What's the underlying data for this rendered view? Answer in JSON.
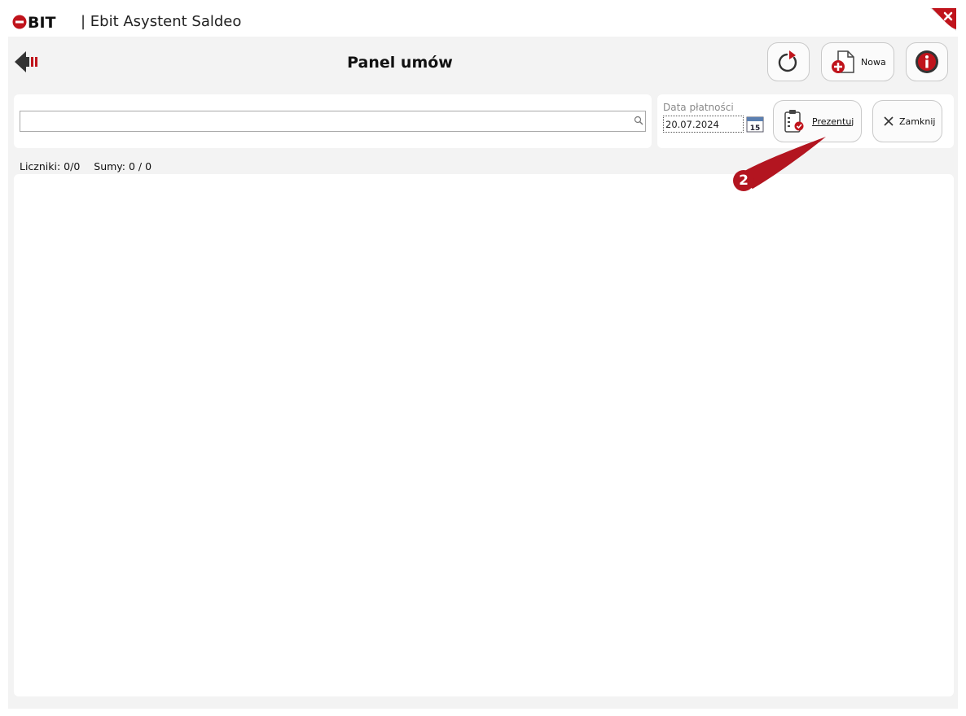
{
  "app": {
    "logo_text": "BIT",
    "title": "| Ebit Asystent Saldeo"
  },
  "header": {
    "page_title": "Panel umów",
    "new_label": "Nowa"
  },
  "search": {
    "value": "",
    "placeholder": ""
  },
  "filter": {
    "date_label": "Data płatności",
    "date_value": "20.07.2024",
    "calendar_day": "15",
    "present_label": "Prezentuj",
    "close_label": "Zamknij"
  },
  "status": {
    "counters": "Liczniki: 0/0",
    "sums": "Sumy: 0 / 0"
  },
  "annotation": {
    "step_number": "2"
  },
  "colors": {
    "accent_red": "#c0141c",
    "panel_bg": "#f3f3f3"
  }
}
